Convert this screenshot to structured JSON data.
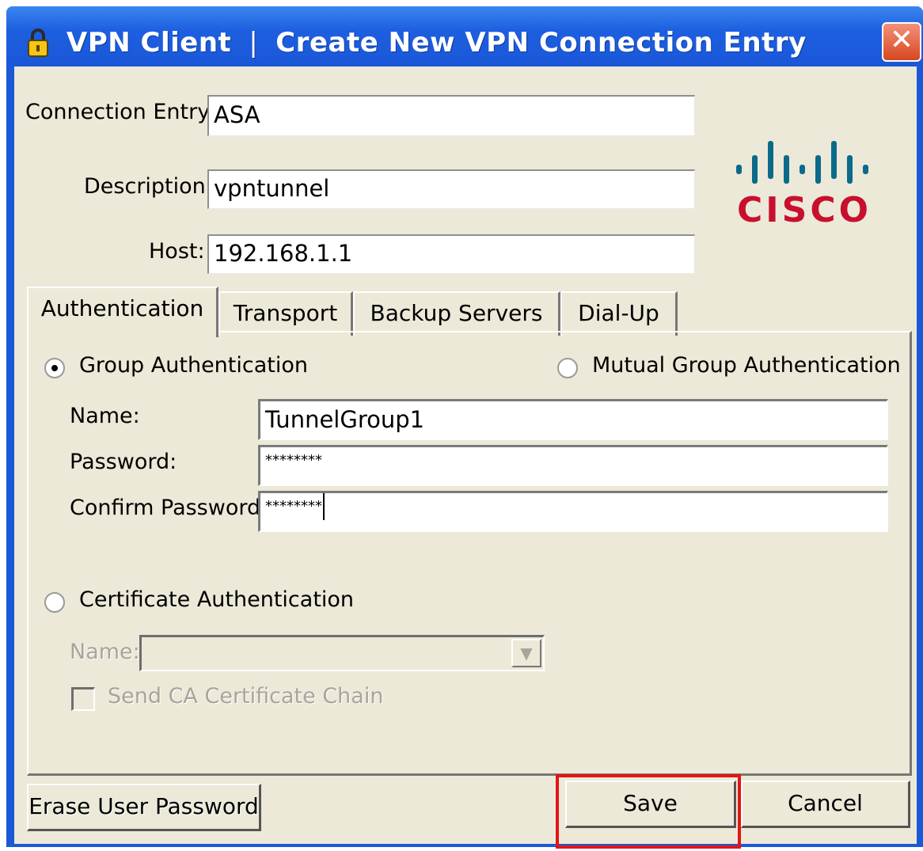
{
  "window": {
    "title": "VPN Client",
    "separator": "|",
    "subtitle": "Create New VPN Connection Entry",
    "close_glyph": "✕",
    "title_icon": "lock-icon"
  },
  "form": {
    "connection_entry_label": "Connection Entry:",
    "connection_entry_value": "ASA",
    "description_label": "Description:",
    "description_value": "vpntunnel",
    "host_label": "Host:",
    "host_value": "192.168.1.1"
  },
  "logo": {
    "text": "CISCO",
    "color": "#c8102e",
    "bars_color": "#0b6a8a"
  },
  "tabs": [
    {
      "label": "Authentication",
      "active": true
    },
    {
      "label": "Transport"
    },
    {
      "label": "Backup Servers"
    },
    {
      "label": "Dial-Up"
    }
  ],
  "auth": {
    "group_auth_label": "Group Authentication",
    "group_auth_selected": true,
    "mutual_auth_label": "Mutual Group Authentication",
    "name_label": "Name:",
    "name_value": "TunnelGroup1",
    "password_label": "Password:",
    "password_value": "********",
    "confirm_label": "Confirm Password:",
    "confirm_value": "********",
    "cert_auth_label": "Certificate Authentication",
    "cert_name_label": "Name:",
    "send_ca_label": "Send CA Certificate Chain"
  },
  "buttons": {
    "erase_label": "Erase User Password",
    "save_label": "Save",
    "cancel_label": "Cancel"
  },
  "colors": {
    "highlight": "#e31515",
    "titlebar": "#1d5fe0",
    "face": "#ece9d8"
  }
}
